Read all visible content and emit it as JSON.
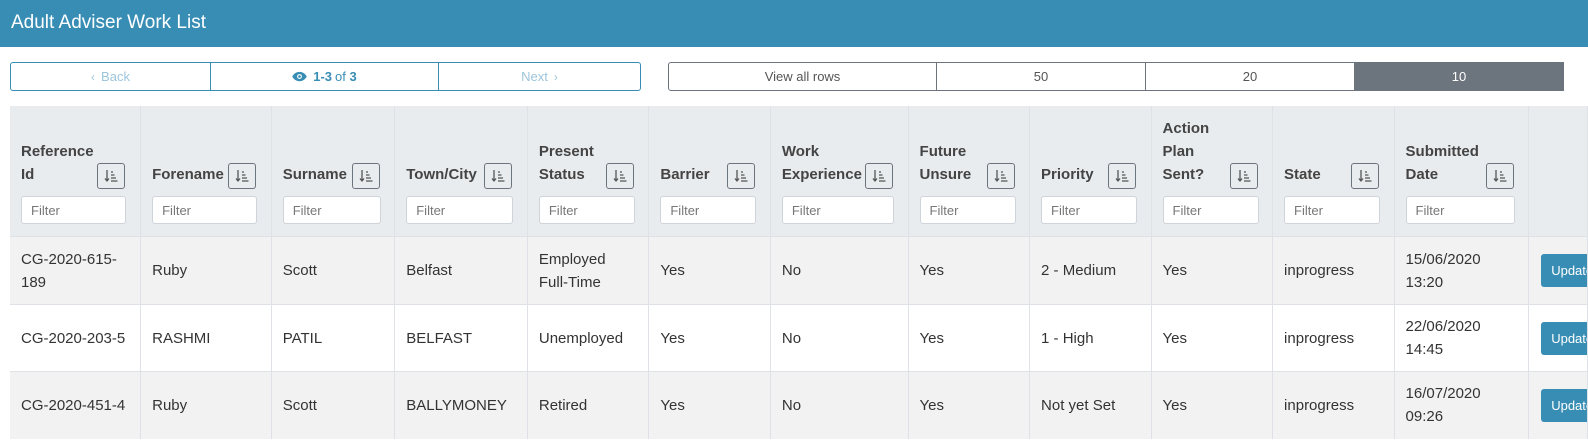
{
  "header": {
    "title": "Adult Adviser Work List"
  },
  "pager": {
    "back_label": "Back",
    "range": "1-3",
    "of_label": "of",
    "total": "3",
    "next_label": "Next"
  },
  "rows_per_page": {
    "options": [
      "View all rows",
      "50",
      "20",
      "10"
    ],
    "selected": "10"
  },
  "table": {
    "filter_placeholder": "Filter",
    "columns": [
      {
        "label1": "Reference",
        "label2": "Id"
      },
      {
        "label1": "",
        "label2": "Forename"
      },
      {
        "label1": "",
        "label2": "Surname"
      },
      {
        "label1": "",
        "label2": "Town/City"
      },
      {
        "label1": "Present",
        "label2": "Status"
      },
      {
        "label1": "",
        "label2": "Barrier"
      },
      {
        "label1": "Work",
        "label2": "Experience"
      },
      {
        "label1": "Future",
        "label2": "Unsure"
      },
      {
        "label1": "",
        "label2": "Priority"
      },
      {
        "label1": "Action",
        "label2": "Plan",
        "label3": "Sent?"
      },
      {
        "label1": "",
        "label2": "State"
      },
      {
        "label1": "Submitted",
        "label2": "Date"
      }
    ],
    "rows": [
      {
        "ref1": "CG-2020-615-",
        "ref2": "189",
        "forename": "Ruby",
        "surname": "Scott",
        "town": "Belfast",
        "status1": "Employed",
        "status2": "Full-Time",
        "barrier": "Yes",
        "work": "No",
        "future": "Yes",
        "priority": "2 - Medium",
        "plan": "Yes",
        "state": "inprogress",
        "date": "15/06/2020",
        "time": "13:20",
        "action": "Update"
      },
      {
        "ref1": "CG-2020-203-5",
        "ref2": "",
        "forename": "RASHMI",
        "surname": "PATIL",
        "town": "BELFAST",
        "status1": "Unemployed",
        "status2": "",
        "barrier": "Yes",
        "work": "No",
        "future": "Yes",
        "priority": "1 - High",
        "plan": "Yes",
        "state": "inprogress",
        "date": "22/06/2020",
        "time": "14:45",
        "action": "Update"
      },
      {
        "ref1": "CG-2020-451-4",
        "ref2": "",
        "forename": "Ruby",
        "surname": "Scott",
        "town": "BALLYMONEY",
        "status1": "Retired",
        "status2": "",
        "barrier": "Yes",
        "work": "No",
        "future": "Yes",
        "priority": "Not yet Set",
        "plan": "Yes",
        "state": "inprogress",
        "date": "16/07/2020",
        "time": "09:26",
        "action": "Update"
      }
    ]
  },
  "icons": {
    "back": "chevron-left-icon",
    "next": "chevron-right-icon",
    "eye": "eye-icon",
    "sort": "sort-icon"
  }
}
